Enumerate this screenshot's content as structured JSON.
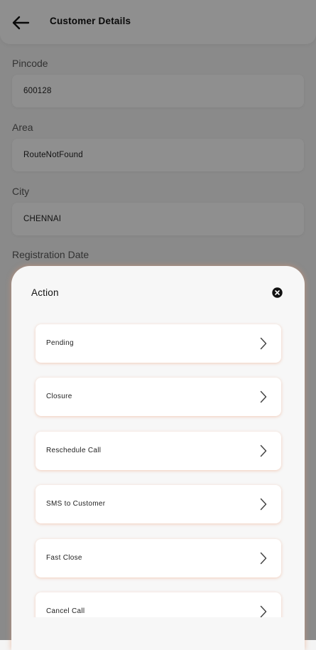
{
  "header": {
    "title": "Customer Details"
  },
  "fields": [
    {
      "label": "Pincode",
      "value": "600128"
    },
    {
      "label": "Area",
      "value": "RouteNotFound"
    },
    {
      "label": "City",
      "value": "CHENNAI"
    },
    {
      "label": "Registration Date",
      "value": ""
    }
  ],
  "action_sheet": {
    "title": "Action",
    "items": [
      {
        "label": "Pending"
      },
      {
        "label": "Closure"
      },
      {
        "label": "Reschedule Call"
      },
      {
        "label": "SMS to Customer"
      },
      {
        "label": "Fast Close"
      },
      {
        "label": "Cancel Call"
      }
    ]
  },
  "colors": {
    "accent_shadow": "#e8956e",
    "overlay": "#000000"
  },
  "icons": {
    "back": "arrow-left-icon",
    "close": "close-circle-icon",
    "item": "chevron-right-icon"
  }
}
